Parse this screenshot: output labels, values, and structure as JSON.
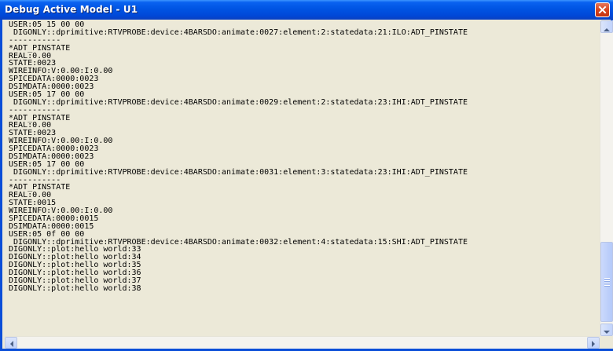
{
  "window": {
    "title": "Debug Active Model - U1"
  },
  "colors": {
    "titlebar": "#0054e3",
    "client_background": "#ece9d8",
    "text": "#000000",
    "close_button": "#d8451f"
  },
  "icons": {
    "close": "close-icon",
    "scroll_up": "arrow-up-icon",
    "scroll_down": "arrow-down-icon",
    "scroll_left": "arrow-left-icon",
    "scroll_right": "arrow-right-icon"
  },
  "log_lines": [
    "USER:05 15 00 00",
    " DIGONLY::dprimitive:RTVPROBE:device:4BARSDO:animate:0027:element:2:statedata:21:ILO:ADT_PINSTATE",
    "-----------",
    "*ADT_PINSTATE",
    "REAL:0.00",
    "STATE:0023",
    "WIREINFO:V:0.00:I:0.00",
    "SPICEDATA:0000:0023",
    "DSIMDATA:0000:0023",
    "USER:05 17 00 00",
    " DIGONLY::dprimitive:RTVPROBE:device:4BARSDO:animate:0029:element:2:statedata:23:IHI:ADT_PINSTATE",
    "-----------",
    "*ADT_PINSTATE",
    "REAL:0.00",
    "STATE:0023",
    "WIREINFO:V:0.00:I:0.00",
    "SPICEDATA:0000:0023",
    "DSIMDATA:0000:0023",
    "USER:05 17 00 00",
    " DIGONLY::dprimitive:RTVPROBE:device:4BARSDO:animate:0031:element:3:statedata:23:IHI:ADT_PINSTATE",
    "-----------",
    "*ADT_PINSTATE",
    "REAL:0.00",
    "STATE:0015",
    "WIREINFO:V:0.00:I:0.00",
    "SPICEDATA:0000:0015",
    "DSIMDATA:0000:0015",
    "USER:05 0f 00 00",
    " DIGONLY::dprimitive:RTVPROBE:device:4BARSDO:animate:0032:element:4:statedata:15:SHI:ADT_PINSTATE",
    "DIGONLY::plot:hello world:33",
    "DIGONLY::plot:hello world:34",
    "DIGONLY::plot:hello world:35",
    "DIGONLY::plot:hello world:36",
    "DIGONLY::plot:hello world:37",
    "DIGONLY::plot:hello world:38"
  ]
}
